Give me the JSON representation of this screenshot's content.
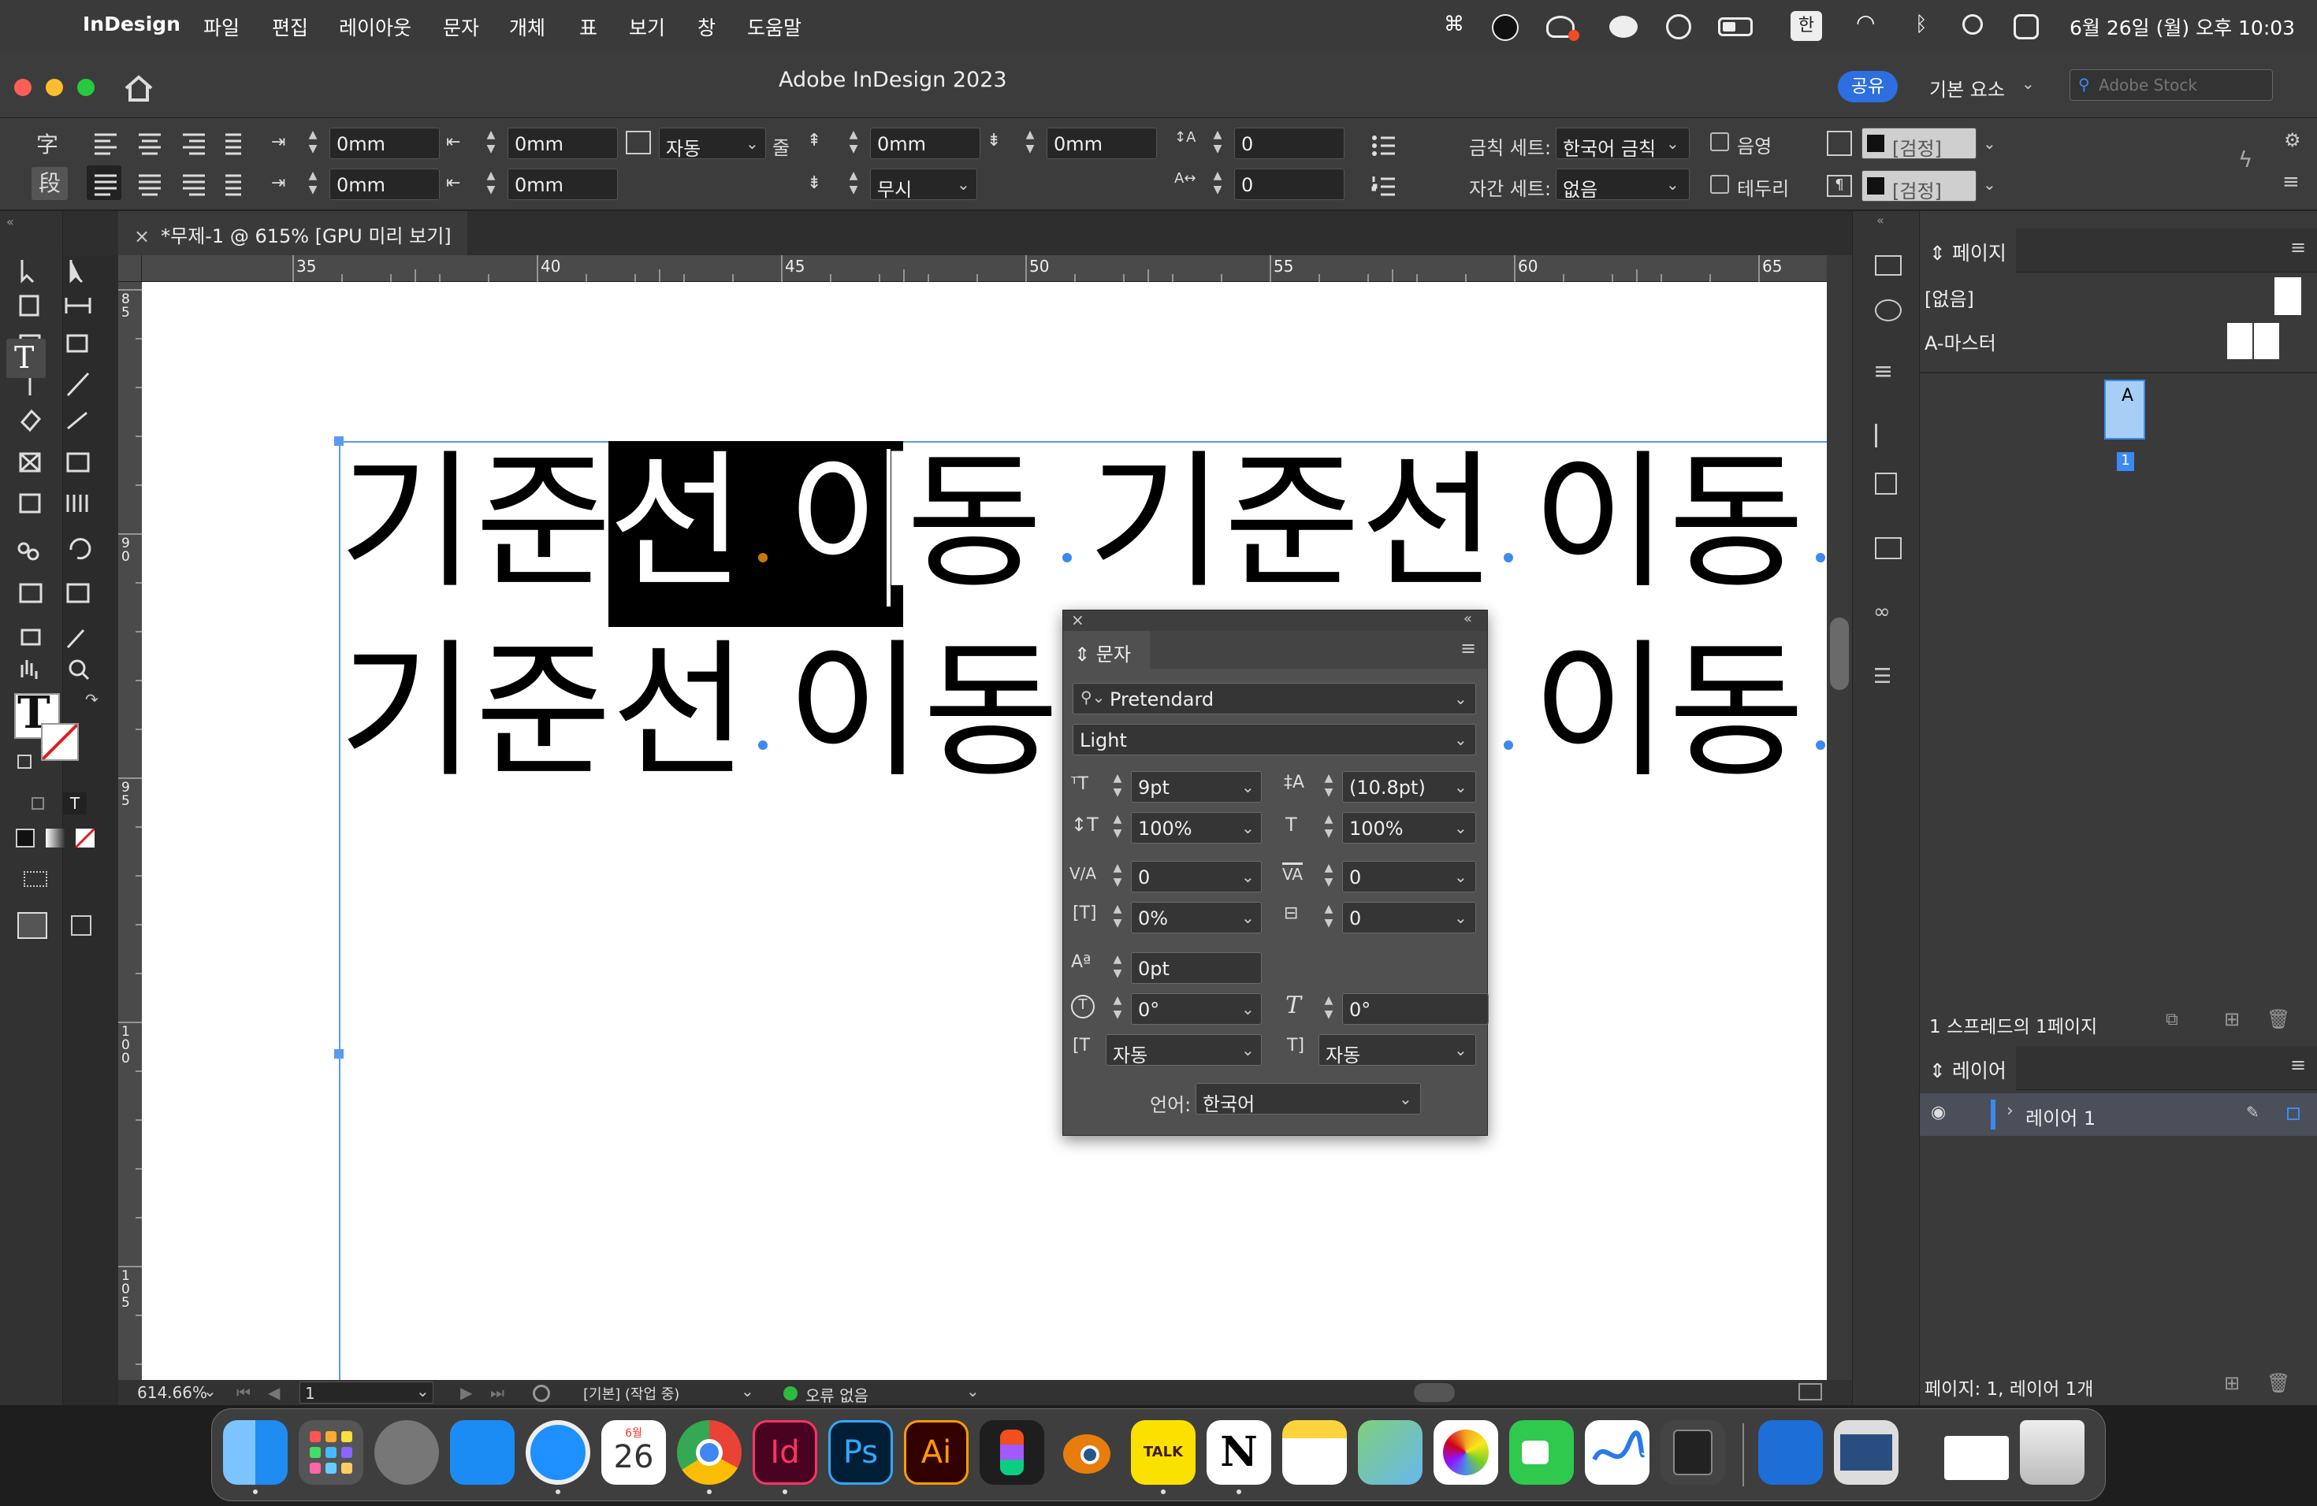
{
  "menubar": {
    "app_name": "InDesign",
    "menus": [
      "파일",
      "편집",
      "레이아웃",
      "문자",
      "개체",
      "표",
      "보기",
      "창",
      "도움말"
    ],
    "input_indicator": "한",
    "datetime": "6월 26일 (월) 오후 10:03"
  },
  "titlebar": {
    "title": "Adobe InDesign 2023",
    "share_label": "공유",
    "workspace_label": "기본 요소",
    "stock_placeholder": "Adobe Stock"
  },
  "controlbar": {
    "char_mode_glyph": "字",
    "para_mode_glyph": "段",
    "left_indent": "0mm",
    "right_indent": "0mm",
    "first_indent": "0mm",
    "last_indent": "0mm",
    "grid_align": "자동",
    "grid_align_suffix": "줄",
    "space_before": "0mm",
    "space_after": "0mm",
    "dropcap_lines": "0",
    "dropcap_chars": "0",
    "grid_ignore": "무시",
    "kinsoku_label": "금칙 세트:",
    "kinsoku_value": "한국어 금칙",
    "mojikumi_label": "자간 세트:",
    "mojikumi_value": "없음",
    "shading_label": "음영",
    "border_label": "테두리",
    "swatch1": "[검정]",
    "swatch2": "[검정]"
  },
  "document": {
    "tab_label": "*무제-1 @ 615% [GPU 미리 보기]",
    "ruler_h": [
      "35",
      "40",
      "45",
      "50",
      "55",
      "60",
      "65"
    ],
    "ruler_v": [
      "85",
      "90",
      "95",
      "100",
      "105"
    ],
    "line1_text": [
      "기준",
      "선",
      "이",
      "동",
      "기준선",
      "이동"
    ],
    "line2_text": [
      "기준선",
      "이동",
      "이동"
    ]
  },
  "char_panel": {
    "title": "문자",
    "font_family": "Pretendard",
    "font_style": "Light",
    "font_size": "9pt",
    "leading": "(10.8pt)",
    "vertical_scale": "100%",
    "horizontal_scale": "100%",
    "kerning": "0",
    "tracking": "0",
    "tsume": "0%",
    "aki": "0",
    "baseline_shift": "0pt",
    "rotation": "0°",
    "skew": "0°",
    "mojikumi_before": "자동",
    "mojikumi_after": "자동",
    "language_label": "언어:",
    "language_value": "한국어"
  },
  "pages_panel": {
    "title": "페이지",
    "none_label": "[없음]",
    "master_label": "A-마스터",
    "page_letter": "A",
    "page_number": "1",
    "footer": "1 스프레드의 1페이지"
  },
  "layers_panel": {
    "title": "레이어",
    "layer_name": "레이어 1",
    "footer": "페이지: 1, 레이어 1개"
  },
  "statusbar": {
    "zoom": "614.66%",
    "page": "1",
    "profile": "[기본] (작업 중)",
    "preflight": "오류 없음"
  },
  "dock": {
    "calendar_month": "6월",
    "calendar_day": "26",
    "id_label": "Id",
    "ps_label": "Ps",
    "ai_label": "Ai",
    "talk_label": "TALK",
    "notion_label": "N"
  },
  "colors": {
    "accent": "#3b8af2",
    "share": "#2d6ee0",
    "selection": "#000000",
    "indesign": "#49021f",
    "photoshop": "#001e36",
    "illustrator": "#330000"
  }
}
